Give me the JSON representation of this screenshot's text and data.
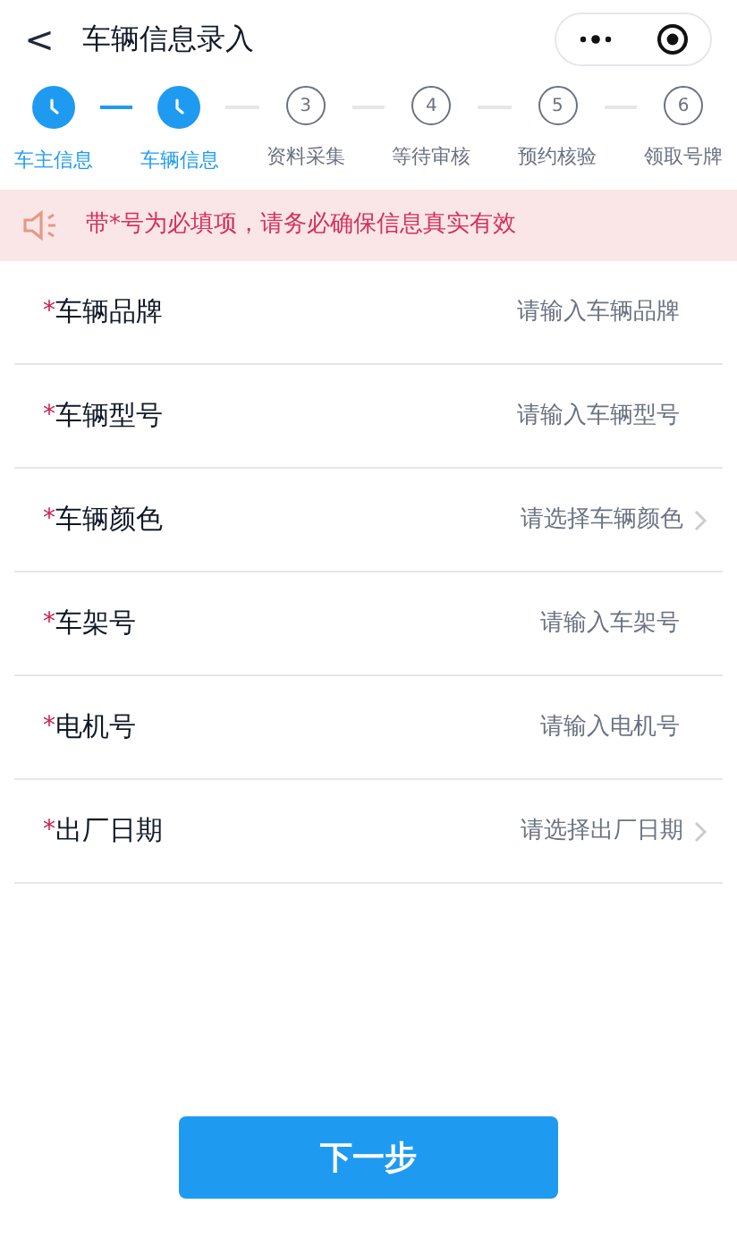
{
  "header": {
    "back": "<",
    "title": "车辆信息录入"
  },
  "steps": [
    {
      "label": "车主信息",
      "completed": true
    },
    {
      "label": "车辆信息",
      "completed": true
    },
    {
      "label": "资料采集",
      "number": "3",
      "completed": false
    },
    {
      "label": "等待审核",
      "number": "4",
      "completed": false
    },
    {
      "label": "预约核验",
      "number": "5",
      "completed": false
    },
    {
      "label": "领取号牌",
      "number": "6",
      "completed": false
    }
  ],
  "notice": "带*号为必填项，请务必确保信息真实有效",
  "fields": [
    {
      "mark": "*",
      "label": "车辆品牌",
      "placeholder": "请输入车辆品牌",
      "kind": "input"
    },
    {
      "mark": "*",
      "label": "车辆型号",
      "placeholder": "请输入车辆型号",
      "kind": "input"
    },
    {
      "mark": "*",
      "label": "车辆颜色",
      "placeholder": "请选择车辆颜色",
      "kind": "select"
    },
    {
      "mark": "*",
      "label": "车架号",
      "placeholder": "请输入车架号",
      "kind": "input"
    },
    {
      "mark": "*",
      "label": "电机号",
      "placeholder": "请输入电机号",
      "kind": "input"
    },
    {
      "mark": "*",
      "label": "出厂日期",
      "placeholder": "请选择出厂日期",
      "kind": "select"
    }
  ],
  "next_button": "下一步"
}
